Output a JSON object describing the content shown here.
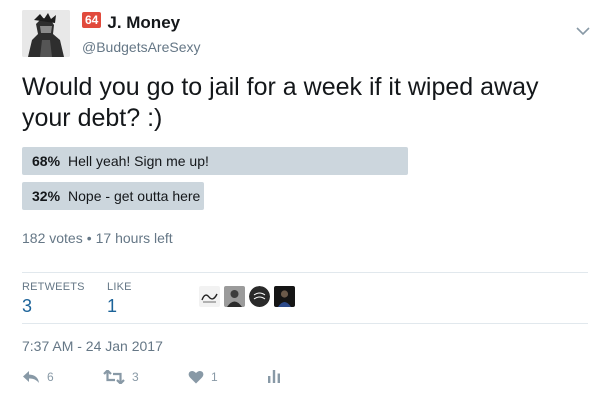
{
  "author": {
    "badge": "64",
    "display_name": "J. Money",
    "handle": "@BudgetsAreSexy"
  },
  "tweet": {
    "text": "Would you go to jail for a week if it wiped away your debt? :)"
  },
  "poll": {
    "options": [
      {
        "percent_label": "68%",
        "percent": 68,
        "label": "Hell yeah! Sign me up!"
      },
      {
        "percent_label": "32%",
        "percent": 32,
        "label": "Nope - get outta here"
      }
    ],
    "votes": "182 votes",
    "time_left": "17 hours left"
  },
  "stats": {
    "retweets_label": "RETWEETS",
    "retweets_value": "3",
    "likes_label": "LIKE",
    "likes_value": "1"
  },
  "timestamp": "7:37 AM - 24 Jan 2017",
  "actions": {
    "reply_count": "6",
    "retweet_count": "3",
    "like_count": "1"
  },
  "colors": {
    "badge": "#e14a3c",
    "poll_bar": "#ccd6dd",
    "stat_value": "#1c6399",
    "muted": "#657786"
  },
  "icons": {
    "menu": "chevron-down-icon",
    "reply": "reply-icon",
    "retweet": "retweet-icon",
    "like": "heart-icon",
    "analytics": "analytics-icon"
  }
}
